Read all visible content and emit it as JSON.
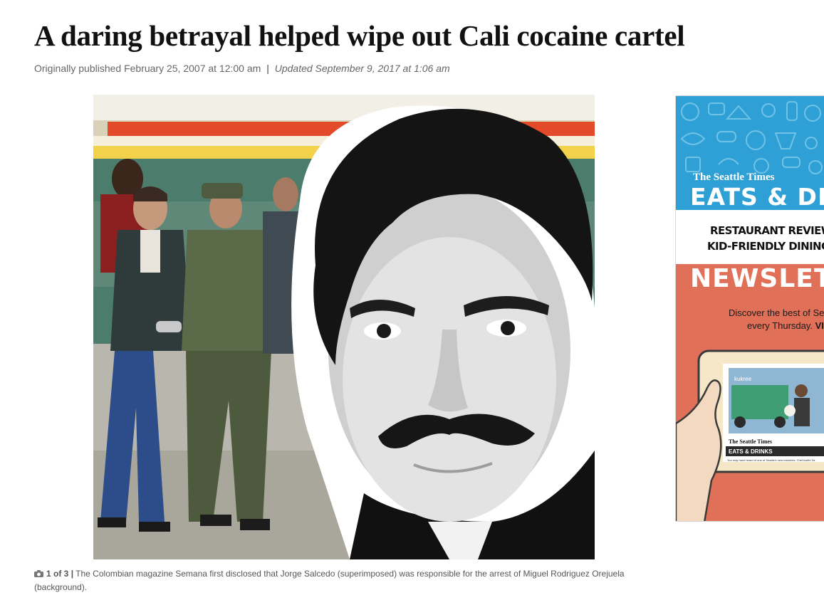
{
  "article": {
    "headline": "A daring betrayal helped wipe out Cali cocaine cartel",
    "published": "Originally published February 25, 2007 at 12:00 am",
    "separator": "|",
    "updated": "Updated September 9, 2017 at 1:06 am"
  },
  "photo": {
    "caption_count": "1 of 3",
    "caption_separator": "|",
    "caption_text": "The Colombian magazine Semana first disclosed that Jorge Salcedo (superimposed) was responsible for the arrest of Miguel Rodriguez Orejuela (background)."
  },
  "ad": {
    "brand": "The Seattle Times",
    "title": "EATS & DRI",
    "subtitle_line1": "RESTAURANT REVIEWS,",
    "subtitle_line2": "KID-FRIENDLY DINING A",
    "newsletter": "NEWSLET",
    "desc_line1": "Discover the best of Se",
    "desc_line2": "every Thursday.",
    "desc_cta": "VI",
    "tablet_brand": "The Seattle Times",
    "tablet_section": "EATS & DRINKS",
    "tablet_truck": "kukree",
    "tablet_blurb": "You may have heard of one of Seattle's new residents: Chef Aarthi Sa"
  },
  "colors": {
    "ad_blue": "#2ea0d6",
    "ad_orange": "#e07158",
    "headline": "#111111",
    "meta": "#666666"
  },
  "icons": {
    "caption": "camera-icon"
  }
}
